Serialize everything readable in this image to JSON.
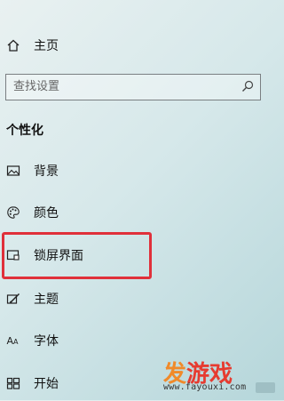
{
  "nav": {
    "home": {
      "label": "主页",
      "icon": "home-icon"
    }
  },
  "search": {
    "placeholder": "查找设置",
    "icon": "search-icon"
  },
  "section": {
    "title": "个性化"
  },
  "items": [
    {
      "label": "背景",
      "icon": "picture-icon"
    },
    {
      "label": "颜色",
      "icon": "palette-icon"
    },
    {
      "label": "锁屏界面",
      "icon": "lock-screen-icon"
    },
    {
      "label": "主题",
      "icon": "theme-icon"
    },
    {
      "label": "字体",
      "icon": "font-icon"
    },
    {
      "label": "开始",
      "icon": "start-icon"
    }
  ],
  "highlight_color": "#e0303a",
  "watermark": {
    "logo": "发游戏",
    "url": "www.fayouxi.com"
  }
}
